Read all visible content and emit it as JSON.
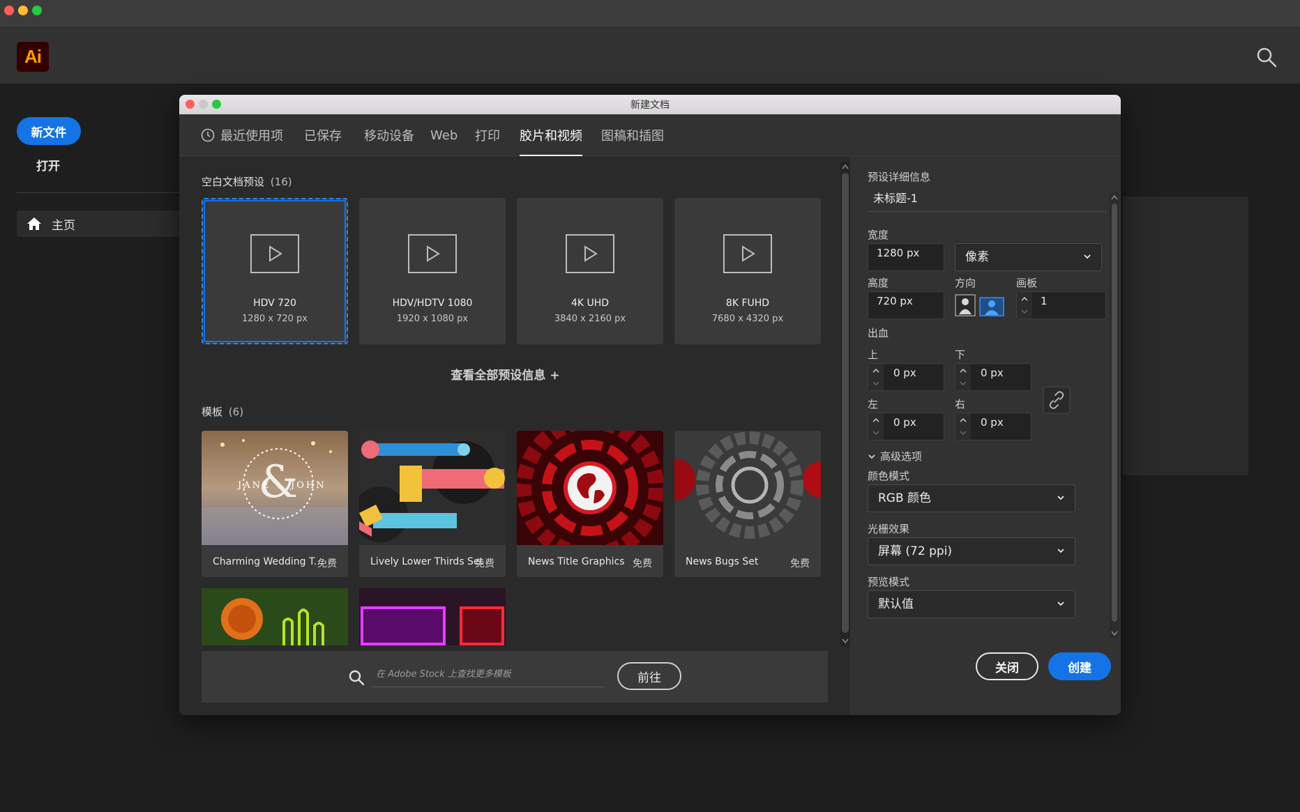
{
  "app": {
    "logo_text": "Ai",
    "brand_color": "#ff9a00",
    "accent": "#1473e6"
  },
  "left_nav": {
    "new_file": "新文件",
    "open": "打开",
    "home": "主页"
  },
  "dialog": {
    "title": "新建文档",
    "tabs": [
      {
        "label": "最近使用项",
        "icon": "clock-icon"
      },
      {
        "label": "已保存"
      },
      {
        "label": "移动设备"
      },
      {
        "label": "Web"
      },
      {
        "label": "打印"
      },
      {
        "label": "胶片和视频",
        "active": true
      },
      {
        "label": "图稿和插图"
      }
    ],
    "presets_heading": "空白文档预设",
    "presets_count": "(16)",
    "presets": [
      {
        "name": "HDV 720",
        "size": "1280 x 720 px",
        "selected": true
      },
      {
        "name": "HDV/HDTV 1080",
        "size": "1920 x 1080 px"
      },
      {
        "name": "4K UHD",
        "size": "3840 x 2160 px"
      },
      {
        "name": "8K FUHD",
        "size": "7680 x 4320 px"
      }
    ],
    "view_all": "查看全部预设信息 +",
    "templates_heading": "模板",
    "templates_count": "(6)",
    "templates": [
      {
        "name": "Charming Wedding T...",
        "price": "免费"
      },
      {
        "name": "Lively Lower Thirds Set",
        "price": "免费"
      },
      {
        "name": "News Title Graphics",
        "price": "免费"
      },
      {
        "name": "News Bugs Set",
        "price": "免费"
      }
    ],
    "stock_placeholder": "在 Adobe Stock 上查找更多模板",
    "goto_button": "前往",
    "details": {
      "heading": "预设详细信息",
      "name": "未标题-1",
      "width_label": "宽度",
      "width": "1280 px",
      "unit": "像素",
      "height_label": "高度",
      "height": "720 px",
      "orientation_label": "方向",
      "artboards_label": "画板",
      "artboards": "1",
      "bleed_label": "出血",
      "top_label": "上",
      "bottom_label": "下",
      "left_label": "左",
      "right_label": "右",
      "bleed_top": "0 px",
      "bleed_bottom": "0 px",
      "bleed_left": "0 px",
      "bleed_right": "0 px",
      "advanced_label": "高级选项",
      "color_mode_label": "颜色模式",
      "color_mode": "RGB 颜色",
      "raster_label": "光栅效果",
      "raster": "屏幕 (72 ppi)",
      "preview_label": "预览模式",
      "preview": "默认值"
    },
    "close_button": "关闭",
    "create_button": "创建"
  }
}
